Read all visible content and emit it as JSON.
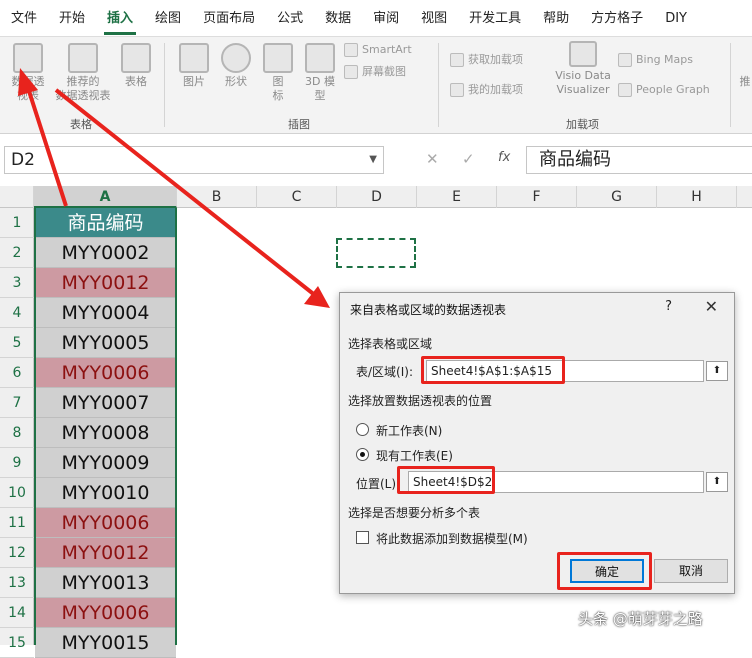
{
  "menu": [
    "文件",
    "开始",
    "插入",
    "绘图",
    "页面布局",
    "公式",
    "数据",
    "审阅",
    "视图",
    "开发工具",
    "帮助",
    "方方格子",
    "DIY"
  ],
  "ribbon": {
    "pivot_label_1": "数据透",
    "pivot_label_2": "视表",
    "rec_pivot_1": "推荐的",
    "rec_pivot_2": "数据透视表",
    "table": "表格",
    "group_table": "表格",
    "picture": "图片",
    "shapes": "形状",
    "icons_1": "图",
    "icons_2": "标",
    "model3d_1": "3D 模",
    "model3d_2": "型",
    "smartart": "SmartArt",
    "screenshot": "屏幕截图",
    "group_illus": "插图",
    "get_addins": "获取加载项",
    "my_addins": "我的加载项",
    "visio_1": "Visio Data",
    "visio_2": "Visualizer",
    "bing_maps": "Bing Maps",
    "people_graph": "People Graph",
    "group_addins": "加载项",
    "more": "推"
  },
  "formula_bar": {
    "name_box": "D2",
    "formula": "商品编码"
  },
  "columns": [
    "A",
    "B",
    "C",
    "D",
    "E",
    "F",
    "G",
    "H"
  ],
  "rows": [
    "1",
    "2",
    "3",
    "4",
    "5",
    "6",
    "7",
    "8",
    "9",
    "10",
    "11",
    "12",
    "13",
    "14",
    "15"
  ],
  "cells": [
    "商品编码",
    "MYY0002",
    "MYY0012",
    "MYY0004",
    "MYY0005",
    "MYY0006",
    "MYY0007",
    "MYY0008",
    "MYY0009",
    "MYY0010",
    "MYY0006",
    "MYY0012",
    "MYY0013",
    "MYY0006",
    "MYY0015"
  ],
  "dialog": {
    "title": "来自表格或区域的数据透视表",
    "help": "?",
    "close": "✕",
    "section1": "选择表格或区域",
    "range_label": "表/区域(I):",
    "range_value": "Sheet4!$A$1:$A$15",
    "section2": "选择放置数据透视表的位置",
    "new_sheet": "新工作表(N)",
    "existing_sheet": "现有工作表(E)",
    "location_label": "位置(L):",
    "location_value": "Sheet4!$D$2",
    "section3": "选择是否想要分析多个表",
    "data_model": "将此数据添加到数据模型(M)",
    "ok": "确定",
    "cancel": "取消"
  },
  "watermark": "头条 @萌芽芽之路",
  "colors": {
    "accent": "#1e7145",
    "highlight": "#e8231d",
    "header_fill": "#3b8a8a",
    "dup_fill": "#cd9aa2"
  }
}
